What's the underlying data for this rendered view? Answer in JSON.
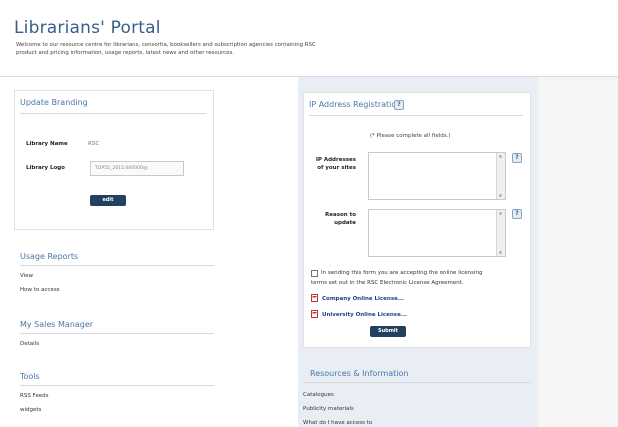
{
  "header": {
    "title": "Librarians' Portal",
    "intro": "Welcome to our resource centre for librarians, consortia, booksellers and subscription agencies containing RSC product and pricing information, usage reports, latest news and other resources."
  },
  "branding": {
    "heading": "Update Branding",
    "library_name_label": "Library Name",
    "library_name_value": "RSC",
    "library_logo_label": "Library Logo",
    "library_logo_value": "TOP55_2015.000000@",
    "edit_button": "edit"
  },
  "usage_reports": {
    "heading": "Usage Reports",
    "links": [
      "View",
      "How to access"
    ]
  },
  "sales_manager": {
    "heading": "My Sales Manager",
    "links": [
      "Details"
    ]
  },
  "tools": {
    "heading": "Tools",
    "links": [
      "RSS Feeds",
      "widgets"
    ]
  },
  "ip_registration": {
    "heading": "IP Address Registration",
    "note": "(* Please complete all fields.)",
    "ip_label_1": "IP Addresses",
    "ip_label_2": "of your sites",
    "reason_label_1": "Reason to",
    "reason_label_2": "update",
    "agree_text_1": "In sending this form you are accepting the online licensing",
    "agree_text_2": "terms set out in the RSC Electronic License Agreement.",
    "license_links": [
      "Company Online License...",
      "University Online License..."
    ],
    "submit_button": "Submit"
  },
  "resources": {
    "heading": "Resources & Information",
    "links": [
      "Catalogues",
      "Publicity materials",
      "What do I have access to"
    ]
  },
  "colors": {
    "heading": "#4b77a7",
    "button": "#22405f",
    "panel": "#e9eef4"
  }
}
